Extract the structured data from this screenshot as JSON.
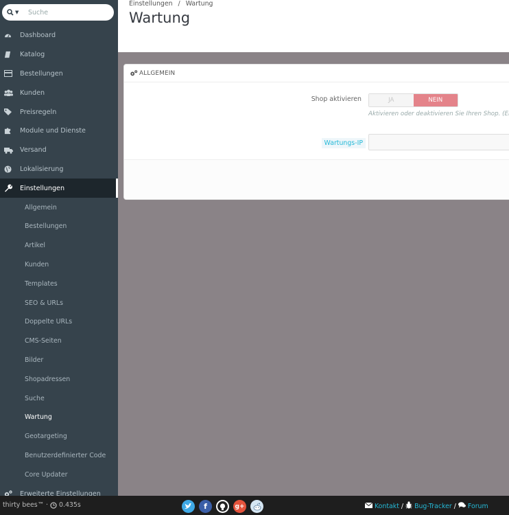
{
  "search": {
    "placeholder": "Suche"
  },
  "sidebar": {
    "items": [
      {
        "label": "Dashboard",
        "icon": "dashboard-icon"
      },
      {
        "label": "Katalog",
        "icon": "book-icon"
      },
      {
        "label": "Bestellungen",
        "icon": "credit-card-icon"
      },
      {
        "label": "Kunden",
        "icon": "users-icon"
      },
      {
        "label": "Preisregeln",
        "icon": "tags-icon"
      },
      {
        "label": "Module und Dienste",
        "icon": "puzzle-icon"
      },
      {
        "label": "Versand",
        "icon": "truck-icon"
      },
      {
        "label": "Lokalisierung",
        "icon": "globe-icon"
      },
      {
        "label": "Einstellungen",
        "icon": "wrench-icon"
      }
    ],
    "subitems": [
      "Allgemein",
      "Bestellungen",
      "Artikel",
      "Kunden",
      "Templates",
      "SEO & URLs",
      "Doppelte URLs",
      "CMS-Seiten",
      "Bilder",
      "Shopadressen",
      "Suche",
      "Wartung",
      "Geotargeting",
      "Benutzerdefinierter Code",
      "Core Updater"
    ],
    "last_item": {
      "label": "Erweiterte Einstellungen",
      "icon": "cogs-icon"
    }
  },
  "header": {
    "breadcrumb_parent": "Einstellungen",
    "breadcrumb_sep": "/",
    "breadcrumb_current": "Wartung",
    "title": "Wartung"
  },
  "panel": {
    "heading": "ALLGEMEIN",
    "shop_label": "Shop aktivieren",
    "toggle_yes": "JA",
    "toggle_no": "NEIN",
    "help": "Aktivieren oder deaktivieren Sie Ihren Shop. (Ei",
    "ip_label": "Wartungs-IP"
  },
  "footer": {
    "brand": "thirty bees™ ·",
    "load_time": "0.435s",
    "contact": "Kontakt",
    "sep": "/",
    "bugtracker": "Bug-Tracker",
    "forum": "Forum"
  },
  "colors": {
    "sidebar_bg": "#36434c",
    "accent": "#25b9d7",
    "toggle_no": "#e4838a",
    "footer_bg": "#1e1e1e"
  }
}
